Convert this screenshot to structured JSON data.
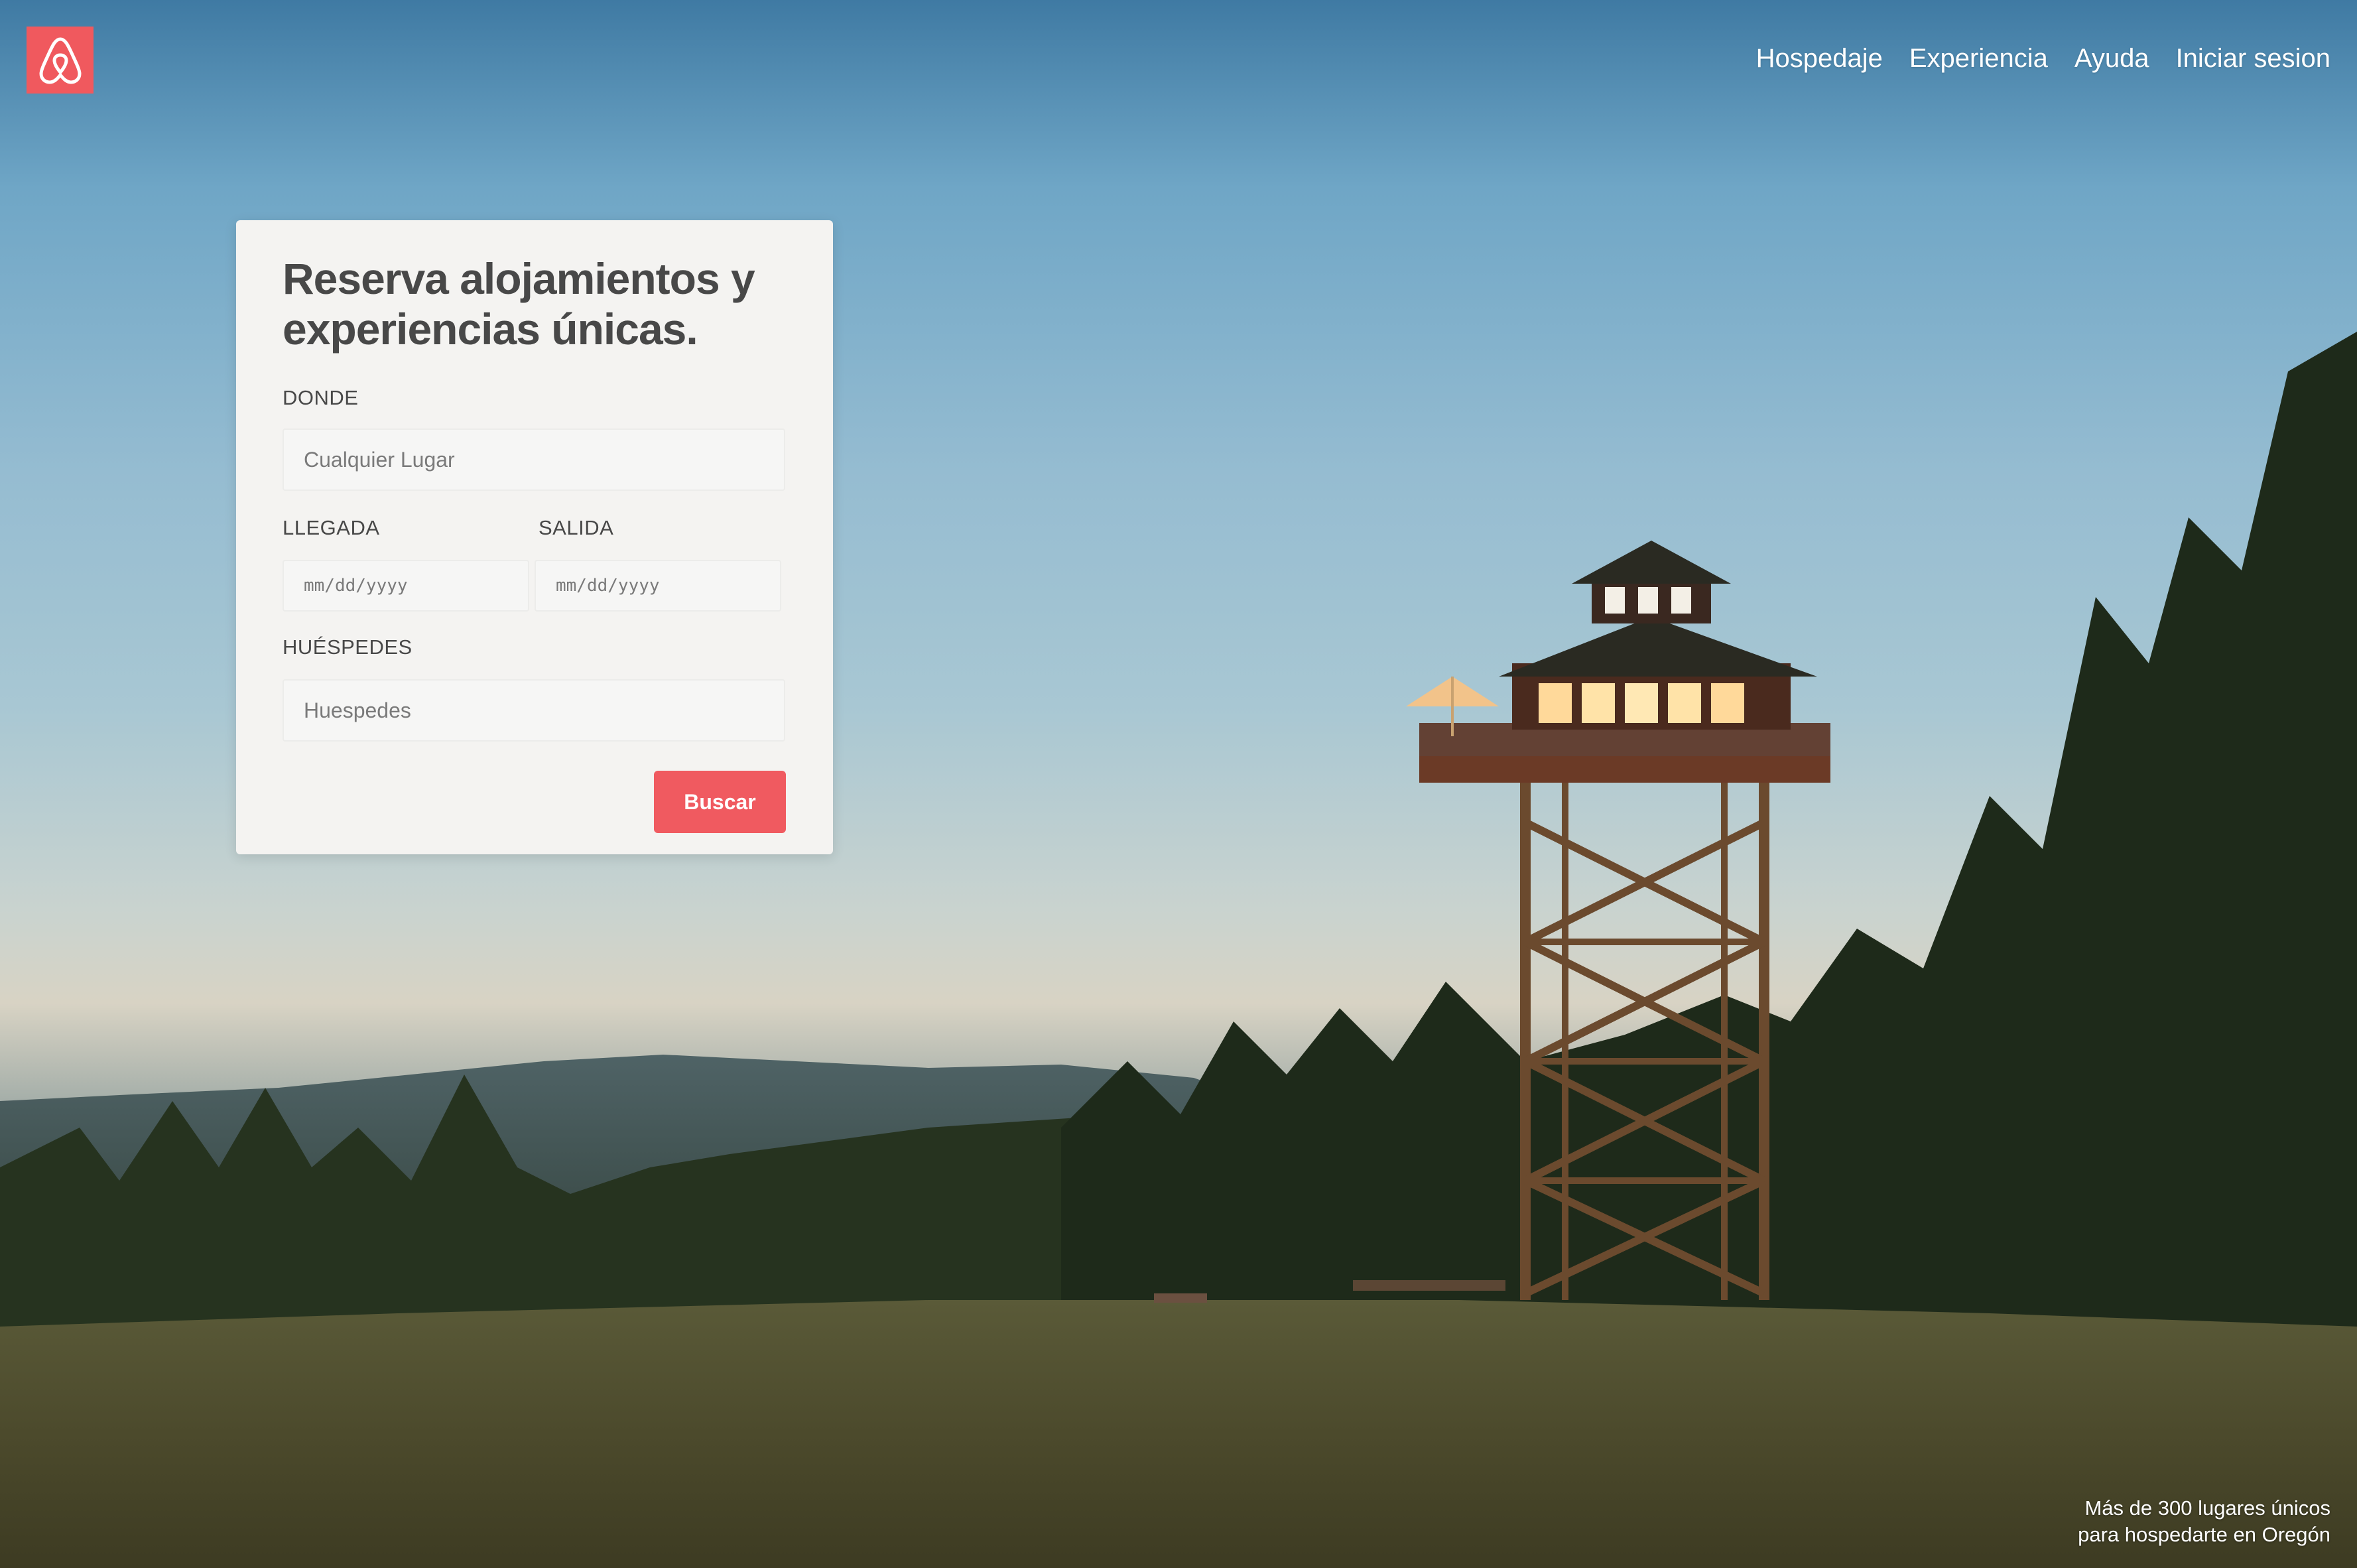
{
  "brand": {
    "logo_icon": "airbnb-belo-icon",
    "accent_color": "#f0595e"
  },
  "nav": {
    "items": [
      {
        "label": "Hospedaje"
      },
      {
        "label": "Experiencia"
      },
      {
        "label": "Ayuda"
      },
      {
        "label": "Iniciar sesion"
      }
    ]
  },
  "booking": {
    "title_line1": "Reserva alojamientos y",
    "title_line2": "experiencias únicas.",
    "where_label": "DONDE",
    "where_placeholder": "Cualquier Lugar",
    "checkin_label": "LLEGADA",
    "checkin_placeholder": "mm/dd/yyyy",
    "checkout_label": "SALIDA",
    "checkout_placeholder": "mm/dd/yyyy",
    "guests_label": "HUÉSPEDES",
    "guests_placeholder": "Huespedes",
    "search_label": "Buscar"
  },
  "hero": {
    "caption_line1": "Más de 300 lugares únicos",
    "caption_line2": "para hospedarte en Oregón"
  }
}
